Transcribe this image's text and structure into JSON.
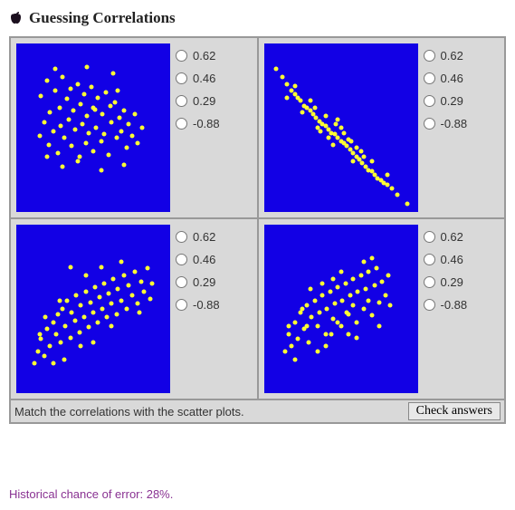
{
  "title": "Guessing Correlations",
  "options": [
    "0.62",
    "0.46",
    "0.29",
    "-0.88"
  ],
  "instruction": "Match the correlations with the scatter plots.",
  "check_button": "Check answers",
  "historical": "Historical chance of error: 28%.",
  "chart_data": [
    {
      "type": "scatter",
      "title": "",
      "xlabel": "",
      "ylabel": "",
      "xlim": [
        0,
        1
      ],
      "ylim": [
        0,
        1
      ],
      "points": [
        [
          0.16,
          0.69
        ],
        [
          0.18,
          0.53
        ],
        [
          0.2,
          0.78
        ],
        [
          0.21,
          0.4
        ],
        [
          0.22,
          0.59
        ],
        [
          0.24,
          0.48
        ],
        [
          0.25,
          0.72
        ],
        [
          0.27,
          0.35
        ],
        [
          0.28,
          0.62
        ],
        [
          0.29,
          0.51
        ],
        [
          0.3,
          0.8
        ],
        [
          0.31,
          0.44
        ],
        [
          0.33,
          0.67
        ],
        [
          0.34,
          0.55
        ],
        [
          0.35,
          0.73
        ],
        [
          0.36,
          0.39
        ],
        [
          0.37,
          0.6
        ],
        [
          0.38,
          0.49
        ],
        [
          0.4,
          0.76
        ],
        [
          0.41,
          0.33
        ],
        [
          0.42,
          0.64
        ],
        [
          0.43,
          0.52
        ],
        [
          0.44,
          0.7
        ],
        [
          0.45,
          0.41
        ],
        [
          0.46,
          0.57
        ],
        [
          0.47,
          0.47
        ],
        [
          0.49,
          0.74
        ],
        [
          0.5,
          0.36
        ],
        [
          0.51,
          0.61
        ],
        [
          0.52,
          0.5
        ],
        [
          0.53,
          0.68
        ],
        [
          0.55,
          0.42
        ],
        [
          0.56,
          0.58
        ],
        [
          0.57,
          0.46
        ],
        [
          0.58,
          0.71
        ],
        [
          0.6,
          0.34
        ],
        [
          0.61,
          0.63
        ],
        [
          0.62,
          0.53
        ],
        [
          0.64,
          0.65
        ],
        [
          0.65,
          0.44
        ],
        [
          0.67,
          0.56
        ],
        [
          0.68,
          0.48
        ],
        [
          0.7,
          0.6
        ],
        [
          0.72,
          0.38
        ],
        [
          0.73,
          0.52
        ],
        [
          0.75,
          0.45
        ],
        [
          0.77,
          0.58
        ],
        [
          0.79,
          0.41
        ],
        [
          0.3,
          0.27
        ],
        [
          0.55,
          0.25
        ],
        [
          0.46,
          0.86
        ],
        [
          0.63,
          0.82
        ],
        [
          0.15,
          0.45
        ],
        [
          0.82,
          0.5
        ],
        [
          0.25,
          0.85
        ],
        [
          0.7,
          0.28
        ],
        [
          0.5,
          0.62
        ],
        [
          0.4,
          0.3
        ],
        [
          0.66,
          0.72
        ],
        [
          0.2,
          0.33
        ]
      ]
    },
    {
      "type": "scatter",
      "title": "",
      "xlabel": "",
      "ylabel": "",
      "xlim": [
        0,
        1
      ],
      "ylim": [
        0,
        1
      ],
      "points": [
        [
          0.08,
          0.85
        ],
        [
          0.12,
          0.8
        ],
        [
          0.15,
          0.76
        ],
        [
          0.18,
          0.72
        ],
        [
          0.2,
          0.7
        ],
        [
          0.22,
          0.68
        ],
        [
          0.24,
          0.66
        ],
        [
          0.26,
          0.63
        ],
        [
          0.28,
          0.62
        ],
        [
          0.3,
          0.6
        ],
        [
          0.32,
          0.58
        ],
        [
          0.34,
          0.56
        ],
        [
          0.36,
          0.54
        ],
        [
          0.38,
          0.52
        ],
        [
          0.4,
          0.51
        ],
        [
          0.42,
          0.49
        ],
        [
          0.44,
          0.47
        ],
        [
          0.46,
          0.46
        ],
        [
          0.48,
          0.44
        ],
        [
          0.5,
          0.42
        ],
        [
          0.52,
          0.41
        ],
        [
          0.54,
          0.39
        ],
        [
          0.56,
          0.37
        ],
        [
          0.58,
          0.35
        ],
        [
          0.6,
          0.33
        ],
        [
          0.62,
          0.31
        ],
        [
          0.64,
          0.29
        ],
        [
          0.66,
          0.27
        ],
        [
          0.68,
          0.25
        ],
        [
          0.7,
          0.24
        ],
        [
          0.72,
          0.22
        ],
        [
          0.74,
          0.2
        ],
        [
          0.76,
          0.19
        ],
        [
          0.78,
          0.17
        ],
        [
          0.8,
          0.16
        ],
        [
          0.83,
          0.14
        ],
        [
          0.87,
          0.1
        ],
        [
          0.93,
          0.05
        ],
        [
          0.25,
          0.59
        ],
        [
          0.35,
          0.5
        ],
        [
          0.45,
          0.4
        ],
        [
          0.55,
          0.43
        ],
        [
          0.48,
          0.55
        ],
        [
          0.52,
          0.47
        ],
        [
          0.4,
          0.57
        ],
        [
          0.6,
          0.38
        ],
        [
          0.3,
          0.66
        ],
        [
          0.65,
          0.33
        ],
        [
          0.5,
          0.5
        ],
        [
          0.42,
          0.44
        ],
        [
          0.58,
          0.3
        ],
        [
          0.7,
          0.3
        ],
        [
          0.2,
          0.75
        ],
        [
          0.15,
          0.68
        ],
        [
          0.8,
          0.22
        ],
        [
          0.37,
          0.48
        ],
        [
          0.47,
          0.52
        ],
        [
          0.57,
          0.42
        ],
        [
          0.33,
          0.62
        ],
        [
          0.63,
          0.36
        ]
      ]
    },
    {
      "type": "scatter",
      "title": "",
      "xlabel": "",
      "ylabel": "",
      "xlim": [
        0,
        1
      ],
      "ylim": [
        0,
        1
      ],
      "points": [
        [
          0.12,
          0.18
        ],
        [
          0.14,
          0.25
        ],
        [
          0.16,
          0.32
        ],
        [
          0.18,
          0.22
        ],
        [
          0.2,
          0.38
        ],
        [
          0.22,
          0.28
        ],
        [
          0.24,
          0.42
        ],
        [
          0.26,
          0.35
        ],
        [
          0.27,
          0.47
        ],
        [
          0.29,
          0.3
        ],
        [
          0.3,
          0.5
        ],
        [
          0.32,
          0.4
        ],
        [
          0.33,
          0.55
        ],
        [
          0.35,
          0.33
        ],
        [
          0.36,
          0.48
        ],
        [
          0.38,
          0.43
        ],
        [
          0.39,
          0.58
        ],
        [
          0.41,
          0.36
        ],
        [
          0.42,
          0.52
        ],
        [
          0.44,
          0.45
        ],
        [
          0.45,
          0.6
        ],
        [
          0.47,
          0.39
        ],
        [
          0.48,
          0.54
        ],
        [
          0.5,
          0.48
        ],
        [
          0.51,
          0.63
        ],
        [
          0.53,
          0.42
        ],
        [
          0.54,
          0.57
        ],
        [
          0.56,
          0.5
        ],
        [
          0.57,
          0.65
        ],
        [
          0.59,
          0.45
        ],
        [
          0.6,
          0.59
        ],
        [
          0.62,
          0.53
        ],
        [
          0.63,
          0.68
        ],
        [
          0.65,
          0.47
        ],
        [
          0.66,
          0.62
        ],
        [
          0.68,
          0.55
        ],
        [
          0.7,
          0.7
        ],
        [
          0.72,
          0.5
        ],
        [
          0.73,
          0.64
        ],
        [
          0.75,
          0.58
        ],
        [
          0.77,
          0.72
        ],
        [
          0.79,
          0.53
        ],
        [
          0.81,
          0.66
        ],
        [
          0.83,
          0.6
        ],
        [
          0.85,
          0.74
        ],
        [
          0.87,
          0.56
        ],
        [
          0.24,
          0.18
        ],
        [
          0.31,
          0.2
        ],
        [
          0.5,
          0.3
        ],
        [
          0.62,
          0.4
        ],
        [
          0.35,
          0.75
        ],
        [
          0.42,
          0.28
        ],
        [
          0.55,
          0.75
        ],
        [
          0.68,
          0.78
        ],
        [
          0.28,
          0.55
        ],
        [
          0.8,
          0.48
        ],
        [
          0.45,
          0.7
        ],
        [
          0.19,
          0.45
        ],
        [
          0.88,
          0.65
        ],
        [
          0.15,
          0.35
        ]
      ]
    },
    {
      "type": "scatter",
      "title": "",
      "xlabel": "",
      "ylabel": "",
      "xlim": [
        0,
        1
      ],
      "ylim": [
        0,
        1
      ],
      "points": [
        [
          0.14,
          0.25
        ],
        [
          0.16,
          0.35
        ],
        [
          0.18,
          0.28
        ],
        [
          0.2,
          0.42
        ],
        [
          0.22,
          0.32
        ],
        [
          0.24,
          0.48
        ],
        [
          0.26,
          0.38
        ],
        [
          0.28,
          0.52
        ],
        [
          0.29,
          0.3
        ],
        [
          0.31,
          0.45
        ],
        [
          0.33,
          0.55
        ],
        [
          0.35,
          0.4
        ],
        [
          0.36,
          0.48
        ],
        [
          0.38,
          0.58
        ],
        [
          0.4,
          0.35
        ],
        [
          0.41,
          0.5
        ],
        [
          0.43,
          0.6
        ],
        [
          0.45,
          0.44
        ],
        [
          0.46,
          0.53
        ],
        [
          0.48,
          0.63
        ],
        [
          0.5,
          0.4
        ],
        [
          0.51,
          0.55
        ],
        [
          0.53,
          0.65
        ],
        [
          0.55,
          0.47
        ],
        [
          0.56,
          0.58
        ],
        [
          0.58,
          0.68
        ],
        [
          0.6,
          0.42
        ],
        [
          0.61,
          0.6
        ],
        [
          0.63,
          0.7
        ],
        [
          0.65,
          0.5
        ],
        [
          0.66,
          0.62
        ],
        [
          0.68,
          0.72
        ],
        [
          0.7,
          0.46
        ],
        [
          0.72,
          0.64
        ],
        [
          0.73,
          0.74
        ],
        [
          0.75,
          0.54
        ],
        [
          0.77,
          0.66
        ],
        [
          0.79,
          0.58
        ],
        [
          0.81,
          0.7
        ],
        [
          0.2,
          0.2
        ],
        [
          0.3,
          0.62
        ],
        [
          0.4,
          0.28
        ],
        [
          0.5,
          0.72
        ],
        [
          0.6,
          0.33
        ],
        [
          0.7,
          0.8
        ],
        [
          0.25,
          0.5
        ],
        [
          0.35,
          0.25
        ],
        [
          0.45,
          0.68
        ],
        [
          0.55,
          0.35
        ],
        [
          0.65,
          0.78
        ],
        [
          0.75,
          0.4
        ],
        [
          0.16,
          0.4
        ],
        [
          0.82,
          0.52
        ],
        [
          0.48,
          0.42
        ],
        [
          0.58,
          0.52
        ],
        [
          0.38,
          0.65
        ],
        [
          0.28,
          0.4
        ],
        [
          0.68,
          0.55
        ],
        [
          0.44,
          0.35
        ],
        [
          0.54,
          0.48
        ]
      ]
    }
  ]
}
